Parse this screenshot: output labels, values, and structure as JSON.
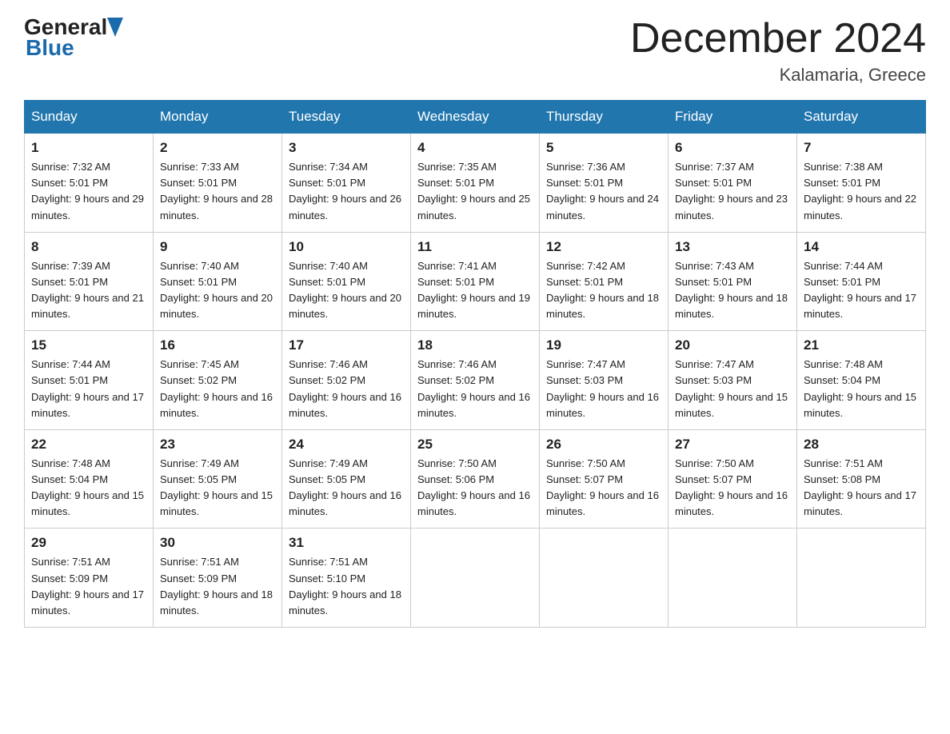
{
  "header": {
    "logo": {
      "general": "General",
      "blue": "Blue"
    },
    "title": "December 2024",
    "location": "Kalamaria, Greece"
  },
  "weekdays": [
    "Sunday",
    "Monday",
    "Tuesday",
    "Wednesday",
    "Thursday",
    "Friday",
    "Saturday"
  ],
  "weeks": [
    [
      {
        "day": "1",
        "sunrise": "7:32 AM",
        "sunset": "5:01 PM",
        "daylight": "9 hours and 29 minutes."
      },
      {
        "day": "2",
        "sunrise": "7:33 AM",
        "sunset": "5:01 PM",
        "daylight": "9 hours and 28 minutes."
      },
      {
        "day": "3",
        "sunrise": "7:34 AM",
        "sunset": "5:01 PM",
        "daylight": "9 hours and 26 minutes."
      },
      {
        "day": "4",
        "sunrise": "7:35 AM",
        "sunset": "5:01 PM",
        "daylight": "9 hours and 25 minutes."
      },
      {
        "day": "5",
        "sunrise": "7:36 AM",
        "sunset": "5:01 PM",
        "daylight": "9 hours and 24 minutes."
      },
      {
        "day": "6",
        "sunrise": "7:37 AM",
        "sunset": "5:01 PM",
        "daylight": "9 hours and 23 minutes."
      },
      {
        "day": "7",
        "sunrise": "7:38 AM",
        "sunset": "5:01 PM",
        "daylight": "9 hours and 22 minutes."
      }
    ],
    [
      {
        "day": "8",
        "sunrise": "7:39 AM",
        "sunset": "5:01 PM",
        "daylight": "9 hours and 21 minutes."
      },
      {
        "day": "9",
        "sunrise": "7:40 AM",
        "sunset": "5:01 PM",
        "daylight": "9 hours and 20 minutes."
      },
      {
        "day": "10",
        "sunrise": "7:40 AM",
        "sunset": "5:01 PM",
        "daylight": "9 hours and 20 minutes."
      },
      {
        "day": "11",
        "sunrise": "7:41 AM",
        "sunset": "5:01 PM",
        "daylight": "9 hours and 19 minutes."
      },
      {
        "day": "12",
        "sunrise": "7:42 AM",
        "sunset": "5:01 PM",
        "daylight": "9 hours and 18 minutes."
      },
      {
        "day": "13",
        "sunrise": "7:43 AM",
        "sunset": "5:01 PM",
        "daylight": "9 hours and 18 minutes."
      },
      {
        "day": "14",
        "sunrise": "7:44 AM",
        "sunset": "5:01 PM",
        "daylight": "9 hours and 17 minutes."
      }
    ],
    [
      {
        "day": "15",
        "sunrise": "7:44 AM",
        "sunset": "5:01 PM",
        "daylight": "9 hours and 17 minutes."
      },
      {
        "day": "16",
        "sunrise": "7:45 AM",
        "sunset": "5:02 PM",
        "daylight": "9 hours and 16 minutes."
      },
      {
        "day": "17",
        "sunrise": "7:46 AM",
        "sunset": "5:02 PM",
        "daylight": "9 hours and 16 minutes."
      },
      {
        "day": "18",
        "sunrise": "7:46 AM",
        "sunset": "5:02 PM",
        "daylight": "9 hours and 16 minutes."
      },
      {
        "day": "19",
        "sunrise": "7:47 AM",
        "sunset": "5:03 PM",
        "daylight": "9 hours and 16 minutes."
      },
      {
        "day": "20",
        "sunrise": "7:47 AM",
        "sunset": "5:03 PM",
        "daylight": "9 hours and 15 minutes."
      },
      {
        "day": "21",
        "sunrise": "7:48 AM",
        "sunset": "5:04 PM",
        "daylight": "9 hours and 15 minutes."
      }
    ],
    [
      {
        "day": "22",
        "sunrise": "7:48 AM",
        "sunset": "5:04 PM",
        "daylight": "9 hours and 15 minutes."
      },
      {
        "day": "23",
        "sunrise": "7:49 AM",
        "sunset": "5:05 PM",
        "daylight": "9 hours and 15 minutes."
      },
      {
        "day": "24",
        "sunrise": "7:49 AM",
        "sunset": "5:05 PM",
        "daylight": "9 hours and 16 minutes."
      },
      {
        "day": "25",
        "sunrise": "7:50 AM",
        "sunset": "5:06 PM",
        "daylight": "9 hours and 16 minutes."
      },
      {
        "day": "26",
        "sunrise": "7:50 AM",
        "sunset": "5:07 PM",
        "daylight": "9 hours and 16 minutes."
      },
      {
        "day": "27",
        "sunrise": "7:50 AM",
        "sunset": "5:07 PM",
        "daylight": "9 hours and 16 minutes."
      },
      {
        "day": "28",
        "sunrise": "7:51 AM",
        "sunset": "5:08 PM",
        "daylight": "9 hours and 17 minutes."
      }
    ],
    [
      {
        "day": "29",
        "sunrise": "7:51 AM",
        "sunset": "5:09 PM",
        "daylight": "9 hours and 17 minutes."
      },
      {
        "day": "30",
        "sunrise": "7:51 AM",
        "sunset": "5:09 PM",
        "daylight": "9 hours and 18 minutes."
      },
      {
        "day": "31",
        "sunrise": "7:51 AM",
        "sunset": "5:10 PM",
        "daylight": "9 hours and 18 minutes."
      },
      null,
      null,
      null,
      null
    ]
  ]
}
